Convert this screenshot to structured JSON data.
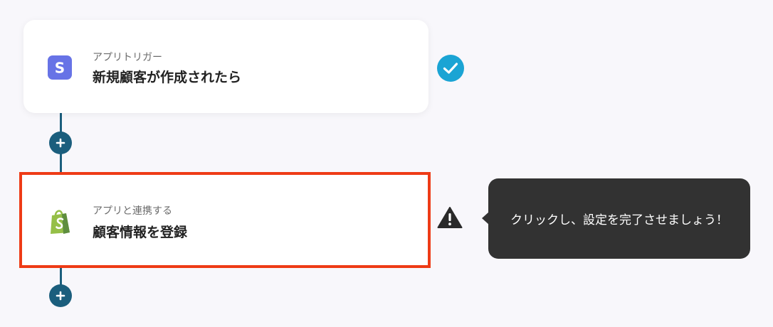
{
  "trigger": {
    "subtitle": "アプリトリガー",
    "title": "新規顧客が作成されたら",
    "icon": "stripe-s-icon",
    "icon_letter": "S",
    "status_icon": "check-icon"
  },
  "action": {
    "subtitle": "アプリと連携する",
    "title": "顧客情報を登録",
    "icon": "shopify-bag-icon",
    "status_icon": "warning-icon"
  },
  "tooltip": {
    "text": "クリックし、設定を完了させましょう！"
  },
  "colors": {
    "background": "#f8f7fb",
    "connector": "#1b5e7d",
    "highlight_border": "#ee3b16",
    "check": "#1ba4d4",
    "stripe": "#6773e6",
    "shopify": "#95bf47",
    "tooltip_bg": "#323232"
  }
}
